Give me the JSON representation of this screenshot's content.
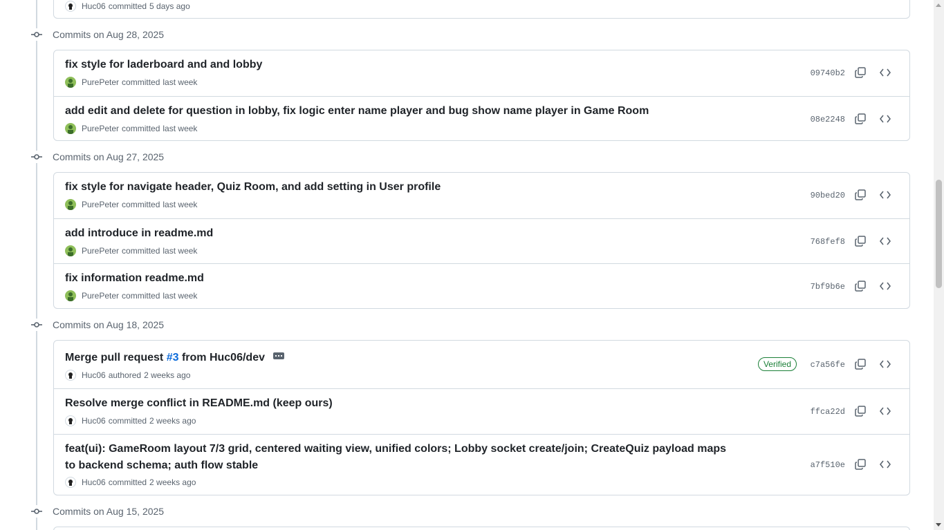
{
  "top_row": {
    "author": "Huc06",
    "action": "committed",
    "when": "5 days ago"
  },
  "groups": [
    {
      "header": "Commits on Aug 28, 2025",
      "commits": [
        {
          "title": "fix style for laderboard and and lobby",
          "author": "PurePeter",
          "action": "committed",
          "when": "last week",
          "sha": "09740b2"
        },
        {
          "title": "add edit and delete for question in lobby, fix logic enter name player and bug show name player in Game Room",
          "author": "PurePeter",
          "action": "committed",
          "when": "last week",
          "sha": "08e2248"
        }
      ]
    },
    {
      "header": "Commits on Aug 27, 2025",
      "commits": [
        {
          "title": "fix style for navigate header, Quiz Room, and add setting in User profile",
          "author": "PurePeter",
          "action": "committed",
          "when": "last week",
          "sha": "90bed20"
        },
        {
          "title": "add introduce in readme.md",
          "author": "PurePeter",
          "action": "committed",
          "when": "last week",
          "sha": "768fef8"
        },
        {
          "title": "fix information readme.md",
          "author": "PurePeter",
          "action": "committed",
          "when": "last week",
          "sha": "7bf9b6e"
        }
      ]
    },
    {
      "header": "Commits on Aug 18, 2025",
      "commits": [
        {
          "title_prefix": "Merge pull request ",
          "pr_link": "#3",
          "title_suffix": " from Huc06/dev",
          "author": "Huc06",
          "action": "authored",
          "when": "2 weeks ago",
          "sha": "c7a56fe",
          "badge": "Verified"
        },
        {
          "title": "Resolve merge conflict in README.md (keep ours)",
          "author": "Huc06",
          "action": "committed",
          "when": "2 weeks ago",
          "sha": "ffca22d"
        },
        {
          "title": "feat(ui): GameRoom layout 7/3 grid, centered waiting view, unified colors; Lobby socket create/join; CreateQuiz payload maps to backend schema; auth flow stable",
          "author": "Huc06",
          "action": "committed",
          "when": "2 weeks ago",
          "sha": "a7f510e"
        }
      ]
    },
    {
      "header": "Commits on Aug 15, 2025"
    }
  ],
  "icons": {
    "commit_node": "git-commit-icon",
    "copy": "copy-icon",
    "browse": "code-browse-icon",
    "avatar_huc": "avatar-huc06",
    "avatar_pure": "avatar-purepeter"
  },
  "colors": {
    "link": "#0969da",
    "verified": "#1a7f37",
    "muted": "#59636e",
    "border": "#d1d9e0"
  }
}
